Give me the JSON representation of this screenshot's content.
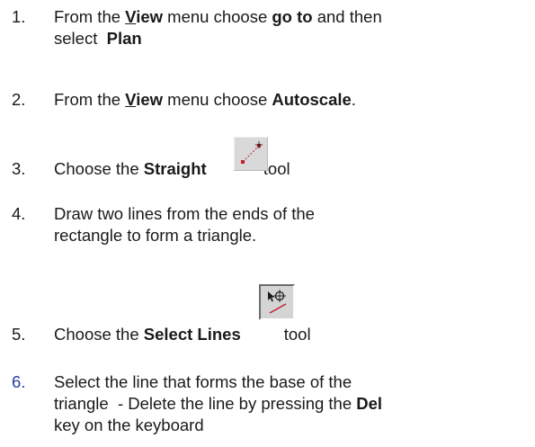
{
  "steps": [
    {
      "number": "1.",
      "parts": [
        "From the ",
        "V",
        "iew",
        " menu choose ",
        "go to",
        " and then",
        "select  ",
        "Plan"
      ]
    },
    {
      "number": "2.",
      "parts": [
        "From the ",
        "V",
        "iew",
        " menu choose ",
        "Autoscale",
        "."
      ]
    },
    {
      "number": "3.",
      "parts": [
        "Choose the ",
        "Straight",
        " tool"
      ],
      "icon": "straight-line-tool-icon"
    },
    {
      "number": "4.",
      "parts": [
        "Draw two lines from the ends of the",
        "rectangle to form a triangle."
      ]
    },
    {
      "number": "5.",
      "parts": [
        "Choose the ",
        "Select Lines",
        "tool"
      ],
      "icon": "select-lines-tool-icon"
    },
    {
      "number": "6.",
      "parts": [
        "Select the line that forms the base of the",
        "triangle  - Delete the line by pressing the ",
        "Del",
        "key on the keyboard"
      ]
    }
  ],
  "colors": {
    "text": "#1a1a1a",
    "step6_number": "#2a3da6",
    "line_red": "#c0202a",
    "tool_bg": "#d4d4d4"
  }
}
